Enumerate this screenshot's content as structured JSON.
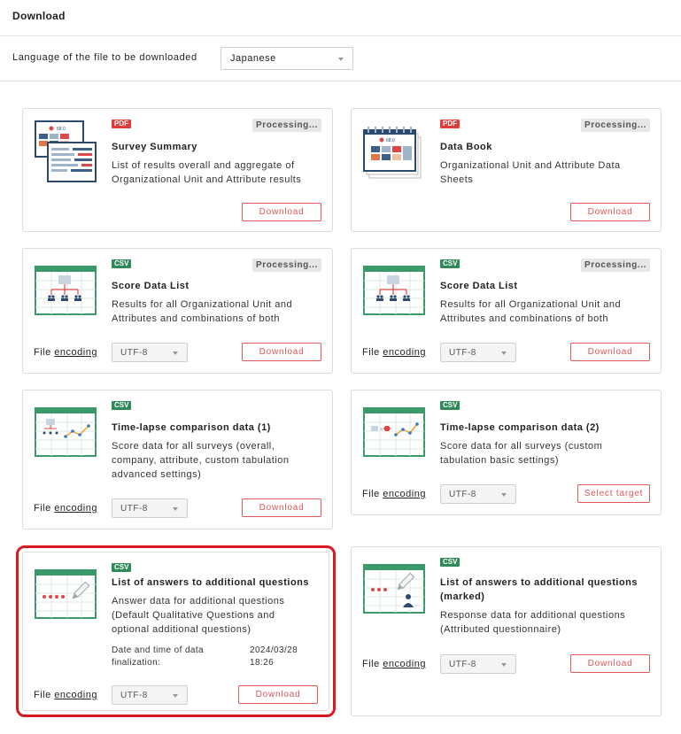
{
  "header": {
    "title": "Download"
  },
  "language": {
    "label": "Language of the file to be downloaded",
    "selected": "Japanese"
  },
  "encoding_label_prefix": "File ",
  "encoding_label_link": "encoding",
  "cards": [
    {
      "badge": "PDF",
      "status": "Processing...",
      "title": "Survey Summary",
      "desc": [
        "List of results overall and aggregate of",
        "Organizational Unit and Attribute results"
      ],
      "button": "Download",
      "thumb_value": "68.0"
    },
    {
      "badge": "PDF",
      "status": "Processing...",
      "title": "Data Book",
      "desc": [
        "Organizational Unit and Attribute Data",
        "Sheets"
      ],
      "button": "Download",
      "thumb_value": "68.0"
    },
    {
      "badge": "CSV",
      "status": "Processing...",
      "title": "Score Data List",
      "desc": [
        "Results for all Organizational Unit and",
        "Attributes and combinations of both"
      ],
      "encoding": "UTF-8",
      "button": "Download"
    },
    {
      "badge": "CSV",
      "status": "Processing...",
      "title": "Score Data List",
      "desc": [
        "Results for all Organizational Unit and",
        "Attributes and combinations of both"
      ],
      "encoding": "UTF-8",
      "button": "Download"
    },
    {
      "badge": "CSV",
      "title": "Time-lapse comparison data (1)",
      "desc": [
        "Score data for all surveys (overall,",
        "company, attribute, custom tabulation",
        "advanced settings)"
      ],
      "encoding": "UTF-8",
      "button": "Download"
    },
    {
      "badge": "CSV",
      "title": "Time-lapse comparison data (2)",
      "desc": [
        "Score data for all surveys (custom",
        "tabulation basic settings)"
      ],
      "encoding": "UTF-8",
      "button": "Select target"
    },
    {
      "badge": "CSV",
      "title": "List of answers to additional questions",
      "desc": [
        "Answer data for additional questions",
        "(Default Qualitative Questions and",
        "optional additional questions)"
      ],
      "meta_label": [
        "Date and time of data",
        "finalization:"
      ],
      "meta_value": [
        "2024/03/28",
        "18:26"
      ],
      "encoding": "UTF-8",
      "button": "Download"
    },
    {
      "badge": "CSV",
      "title_lines": [
        "List of answers to additional questions",
        "(marked)"
      ],
      "desc": [
        "Response data for additional questions",
        "(Attributed questionnaire)"
      ],
      "encoding": "UTF-8",
      "button": "Download"
    }
  ],
  "colors": {
    "accent_red": "#e05555",
    "highlight": "#d71920",
    "csv_green": "#2e8b57",
    "pdf_red": "#e03b3b"
  }
}
